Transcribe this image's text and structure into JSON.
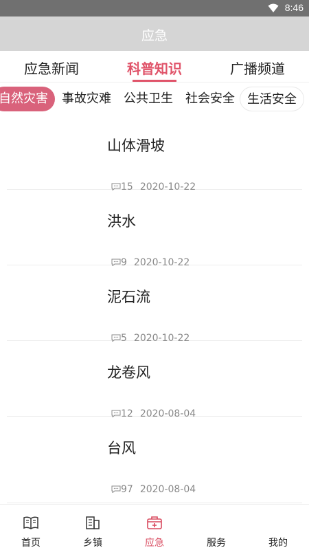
{
  "status_bar": {
    "time": "8:46",
    "wifi_icon": "wifi-icon"
  },
  "app_bar": {
    "title": "应急"
  },
  "tabs": [
    {
      "label": "应急新闻",
      "active": false
    },
    {
      "label": "科普知识",
      "active": true
    },
    {
      "label": "广播频道",
      "active": false
    }
  ],
  "categories": [
    {
      "label": "自然灾害",
      "active": true
    },
    {
      "label": "事故灾难",
      "active": false
    },
    {
      "label": "公共卫生",
      "active": false
    },
    {
      "label": "社会安全",
      "active": false
    },
    {
      "label": "生活安全",
      "active": false
    }
  ],
  "articles": [
    {
      "title": "山体滑坡",
      "comments": "15",
      "date": "2020-10-22"
    },
    {
      "title": "洪水",
      "comments": "9",
      "date": "2020-10-22"
    },
    {
      "title": "泥石流",
      "comments": "5",
      "date": "2020-10-22"
    },
    {
      "title": "龙卷风",
      "comments": "12",
      "date": "2020-08-04"
    },
    {
      "title": "台风",
      "comments": "97",
      "date": "2020-08-04"
    }
  ],
  "bottom_nav": [
    {
      "label": "首页",
      "icon": "book-icon",
      "active": false
    },
    {
      "label": "乡镇",
      "icon": "building-icon",
      "active": false
    },
    {
      "label": "应急",
      "icon": "medkit-icon",
      "active": true
    },
    {
      "label": "服务",
      "icon": "service-icon",
      "active": false
    },
    {
      "label": "我的",
      "icon": "user-icon",
      "active": false
    }
  ],
  "colors": {
    "accent": "#e0546a",
    "chip_active": "#d9627b",
    "app_bar": "#d5d5d5",
    "status_bar": "#707070"
  }
}
